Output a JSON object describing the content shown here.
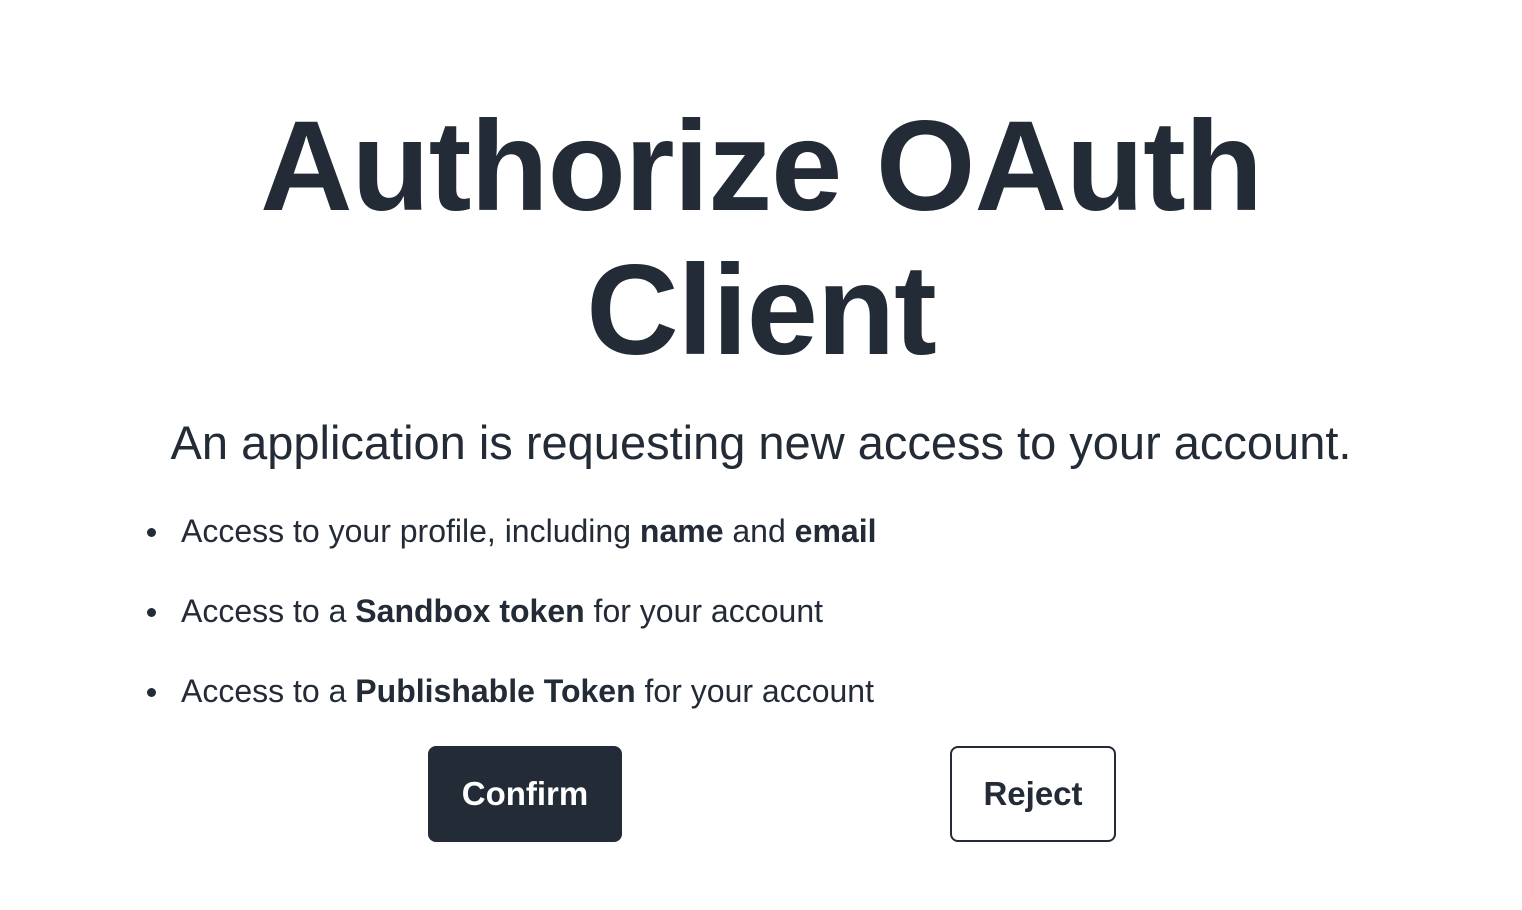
{
  "header": {
    "title_line1": "Authorize OAuth",
    "title_line2": "Client"
  },
  "main": {
    "description": "An application is requesting new access to your account.",
    "permissions": [
      {
        "prefix": "Access to your profile, including ",
        "bold1": "name",
        "middle": " and ",
        "bold2": "email",
        "suffix": ""
      },
      {
        "prefix": "Access to a ",
        "bold1": "Sandbox token",
        "middle": "",
        "bold2": "",
        "suffix": " for your account"
      },
      {
        "prefix": "Access to a ",
        "bold1": "Publishable Token",
        "middle": "",
        "bold2": "",
        "suffix": " for your account"
      }
    ]
  },
  "actions": {
    "confirm_label": "Confirm",
    "reject_label": "Reject"
  },
  "colors": {
    "text": "#222b36",
    "primary_button": "#222b36",
    "background": "#ffffff"
  }
}
